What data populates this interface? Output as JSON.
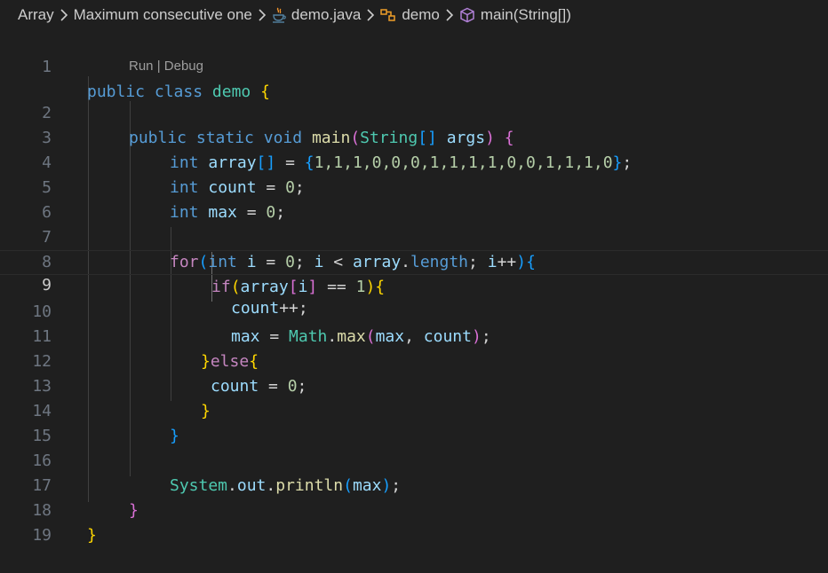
{
  "breadcrumb": {
    "items": [
      {
        "label": "Array",
        "icon": null
      },
      {
        "label": "Maximum consecutive one",
        "icon": null
      },
      {
        "label": "demo.java",
        "icon": "java-coffee-icon"
      },
      {
        "label": "demo",
        "icon": "class-icon"
      },
      {
        "label": "main(String[])",
        "icon": "method-cube-icon"
      }
    ]
  },
  "codelens": {
    "run": "Run",
    "separator": " | ",
    "debug": "Debug"
  },
  "editor": {
    "current_line": 9,
    "line_numbers": [
      "1",
      "2",
      "3",
      "4",
      "5",
      "6",
      "7",
      "8",
      "9",
      "10",
      "11",
      "12",
      "13",
      "14",
      "15",
      "16",
      "17",
      "18",
      "19"
    ]
  },
  "colors": {
    "background": "#1f1f1f",
    "keyword": "#569cd6",
    "control": "#c586c0",
    "type": "#4ec9b0",
    "variable": "#9cdcfe",
    "number": "#b5cea8",
    "function": "#dcdcaa",
    "bracket_gold": "#ffd700",
    "bracket_orchid": "#da70d6",
    "bracket_blue": "#179fff"
  },
  "code": {
    "l1": [
      "public",
      " ",
      "class",
      " ",
      "demo",
      " ",
      "{"
    ],
    "l2": [
      "public",
      " ",
      "static",
      " ",
      "void",
      " ",
      "main",
      "(",
      "String",
      "[]",
      " ",
      "args",
      ")",
      " ",
      "{"
    ],
    "l3": [
      "int",
      " ",
      "array",
      "[]",
      " = ",
      "{",
      "1,1,1,0,0,0,1,1,1,1,0,0,1,1,1,0",
      "}",
      ";"
    ],
    "l4": [
      "int",
      " ",
      "count",
      " = ",
      "0",
      ";"
    ],
    "l5": [
      "int",
      " ",
      "max",
      " = ",
      "0",
      ";"
    ],
    "l7": [
      "for",
      "(",
      "int",
      " ",
      "i",
      " = ",
      "0",
      "; ",
      "i",
      " < ",
      "array",
      ".",
      "length",
      "; ",
      "i",
      "++",
      ")",
      "{"
    ],
    "l8": [
      "if",
      "(",
      "array",
      "[",
      "i",
      "]",
      " == ",
      "1",
      ")",
      "{"
    ],
    "l9": [
      "count",
      "++;"
    ],
    "l10": [
      "max",
      " = ",
      "Math",
      ".",
      "max",
      "(",
      "max",
      ", ",
      "count",
      ")",
      ";"
    ],
    "l11": [
      "}",
      "else",
      "{"
    ],
    "l12": [
      "count",
      " = ",
      "0",
      ";"
    ],
    "l13": [
      "}"
    ],
    "l14": [
      "}"
    ],
    "l16": [
      "System",
      ".",
      "out",
      ".",
      "println",
      "(",
      "max",
      ")",
      ";"
    ],
    "l17": [
      "}"
    ],
    "l18": [
      "}"
    ]
  }
}
